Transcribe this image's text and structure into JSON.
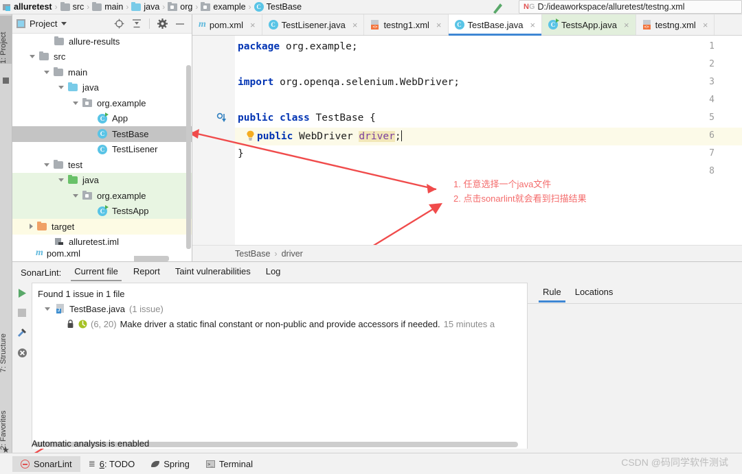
{
  "breadcrumb": {
    "items": [
      {
        "label": "alluretest",
        "icon": "module-icon"
      },
      {
        "label": "src",
        "icon": "folder-icon"
      },
      {
        "label": "main",
        "icon": "folder-icon"
      },
      {
        "label": "java",
        "icon": "source-folder-icon"
      },
      {
        "label": "org",
        "icon": "package-icon"
      },
      {
        "label": "example",
        "icon": "package-icon"
      },
      {
        "label": "TestBase",
        "icon": "class-icon"
      }
    ],
    "separator": "›"
  },
  "run_config": {
    "ng_prefix_n": "N",
    "ng_prefix_g": "G",
    "path": "D:/ideaworkspace/alluretest/testng.xml"
  },
  "left_strip": {
    "project_label": "1: Project",
    "structure_label": "7: Structure",
    "favorites_label": "2: Favorites"
  },
  "project_panel": {
    "title": "Project",
    "tools": [
      "locate-icon",
      "collapse-all-icon",
      "settings-icon",
      "hide-icon"
    ],
    "tree": [
      {
        "label": "allure-results",
        "depth": 2,
        "icon": "folder-icon",
        "twisty": "none",
        "bg": "none"
      },
      {
        "label": "src",
        "depth": 1,
        "icon": "folder-icon",
        "twisty": "down",
        "bg": "none"
      },
      {
        "label": "main",
        "depth": 2,
        "icon": "folder-icon",
        "twisty": "down",
        "bg": "none"
      },
      {
        "label": "java",
        "depth": 3,
        "icon": "source-folder-icon",
        "twisty": "down",
        "bg": "none"
      },
      {
        "label": "org.example",
        "depth": 4,
        "icon": "package-icon",
        "twisty": "down",
        "bg": "none"
      },
      {
        "label": "App",
        "depth": 5,
        "icon": "class-run-icon",
        "twisty": "none",
        "bg": "none"
      },
      {
        "label": "TestBase",
        "depth": 5,
        "icon": "class-icon",
        "twisty": "none",
        "bg": "selected"
      },
      {
        "label": "TestLisener",
        "depth": 5,
        "icon": "class-icon",
        "twisty": "none",
        "bg": "none"
      },
      {
        "label": "test",
        "depth": 2,
        "icon": "folder-icon",
        "twisty": "down",
        "bg": "none"
      },
      {
        "label": "java",
        "depth": 3,
        "icon": "test-source-folder-icon",
        "twisty": "down",
        "bg": "green"
      },
      {
        "label": "org.example",
        "depth": 4,
        "icon": "package-icon",
        "twisty": "down",
        "bg": "green"
      },
      {
        "label": "TestsApp",
        "depth": 5,
        "icon": "class-run-icon",
        "twisty": "none",
        "bg": "green"
      },
      {
        "label": "target",
        "depth": 1,
        "icon": "excluded-folder-icon",
        "twisty": "right",
        "bg": "yellow"
      },
      {
        "label": "alluretest.iml",
        "depth": 2,
        "icon": "iml-file-icon",
        "twisty": "none",
        "bg": "none"
      },
      {
        "label": "pom.xml",
        "depth": 2,
        "icon": "maven-icon",
        "twisty": "none",
        "bg": "none"
      }
    ]
  },
  "editor_tabs": [
    {
      "label": "pom.xml",
      "icon": "maven-icon",
      "state": "normal",
      "close": "×"
    },
    {
      "label": "TestLisener.java",
      "icon": "class-icon",
      "state": "normal",
      "close": "×"
    },
    {
      "label": "testng1.xml",
      "icon": "xml-icon",
      "state": "normal",
      "close": "×"
    },
    {
      "label": "TestBase.java",
      "icon": "class-icon",
      "state": "active",
      "close": "×"
    },
    {
      "label": "TestsApp.java",
      "icon": "class-run-icon",
      "state": "green",
      "close": "×"
    },
    {
      "label": "testng.xml",
      "icon": "xml-icon",
      "state": "normal",
      "close": "×"
    }
  ],
  "editor": {
    "line_numbers": [
      "1",
      "2",
      "3",
      "4",
      "5",
      "6",
      "7",
      "8"
    ],
    "lines": [
      {
        "n": 1,
        "kw": "package",
        "rest": " org.example;"
      },
      {
        "n": 3,
        "kw": "import",
        "rest": " org.openqa.selenium.WebDriver;"
      },
      {
        "n": 5,
        "kw": "public class",
        "rest": " TestBase {"
      },
      {
        "n": 7,
        "kw": "",
        "rest": "}"
      }
    ],
    "field_line": {
      "modifier": "public",
      "type": " WebDriver ",
      "name": "driver",
      "terminator": ";"
    },
    "gutter_marks": {
      "line5": "override-icon",
      "line6": "lightbulb-icon"
    },
    "breadcrumb": {
      "class": "TestBase",
      "sep": "›",
      "member": "driver"
    },
    "pom_tab_label": "pom.xml"
  },
  "annotation": {
    "line1": "1. 任意选择一个java文件",
    "line2": "2. 点击sonarlint就会看到扫描结果",
    "color": "#f46b6b"
  },
  "sonarlint": {
    "label": "SonarLint:",
    "tabs": [
      {
        "label": "Current file",
        "active": true
      },
      {
        "label": "Report",
        "active": false
      },
      {
        "label": "Taint vulnerabilities",
        "active": false
      },
      {
        "label": "Log",
        "active": false
      }
    ],
    "side_actions": [
      "run-analysis-icon",
      "stop-icon",
      "configure-icon",
      "clear-icon"
    ],
    "summary": "Found 1 issue in 1 file",
    "file_node": {
      "name": "TestBase.java",
      "count": "(1 issue)"
    },
    "issue": {
      "position": "(6, 20)",
      "message": "Make driver a static final constant or non-public and provide accessors if needed.",
      "age": "15 minutes a",
      "severity_icon": "lock-icon",
      "type_icon": "code-smell-icon"
    },
    "rule_panel": {
      "tabs": [
        {
          "label": "Rule",
          "active": true
        },
        {
          "label": "Locations",
          "active": false
        }
      ]
    },
    "auto_analysis": "Automatic analysis is enabled"
  },
  "statusbar": {
    "items": [
      {
        "label": "SonarLint",
        "icon": "sonarlint-icon",
        "active": true,
        "prefix": ""
      },
      {
        "label": ": TODO",
        "icon": "todo-icon",
        "active": false,
        "prefix": "6"
      },
      {
        "label": "Spring",
        "icon": "spring-leaf-icon",
        "active": false,
        "prefix": ""
      },
      {
        "label": "Terminal",
        "icon": "terminal-icon",
        "active": false,
        "prefix": ""
      }
    ]
  },
  "watermark": "CSDN @码同学软件测试"
}
